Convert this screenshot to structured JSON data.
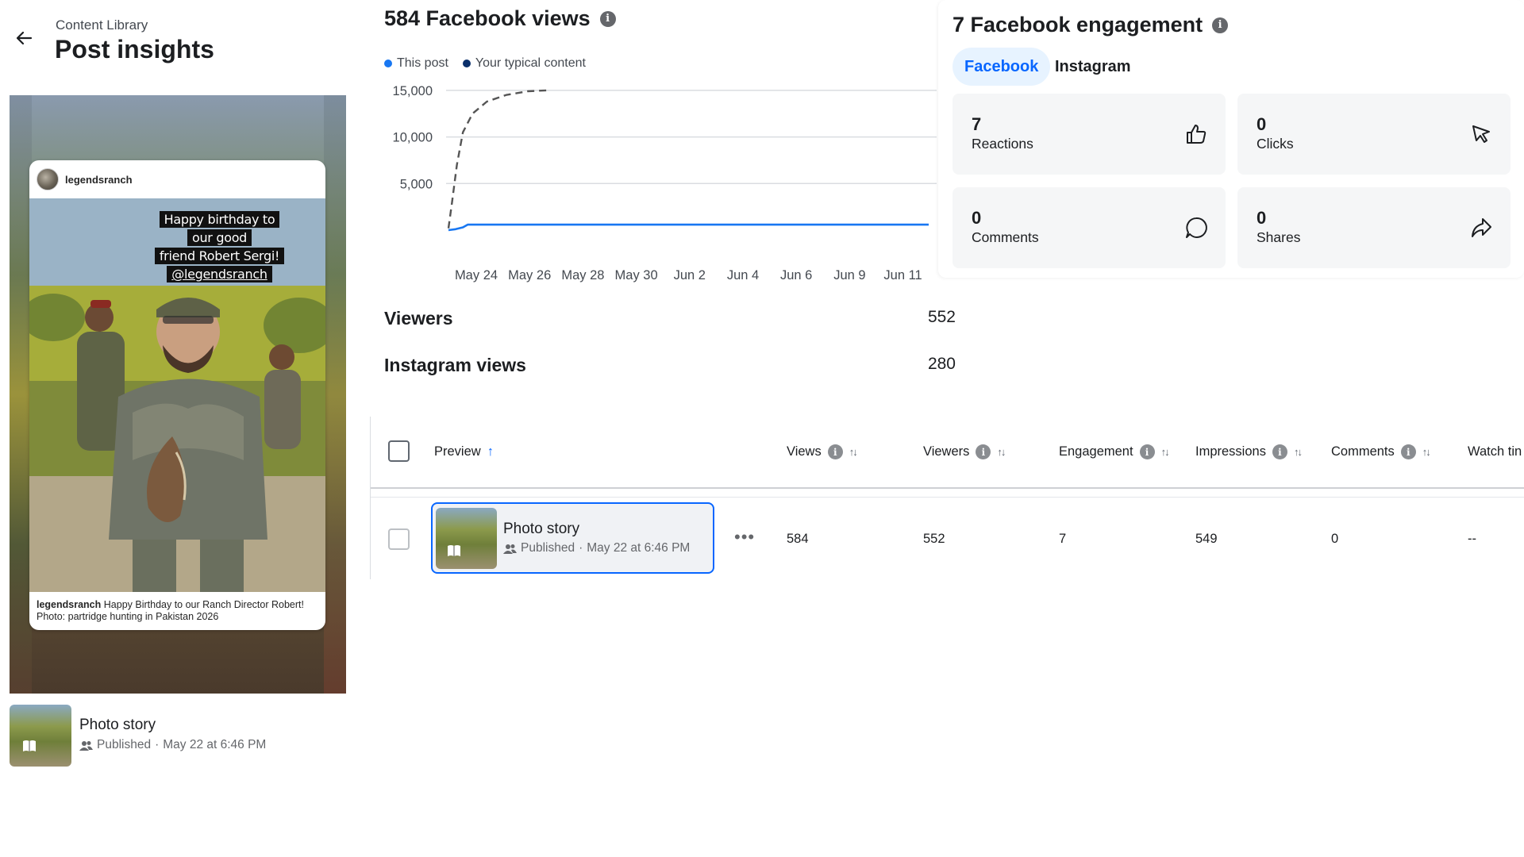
{
  "header": {
    "breadcrumb": "Content Library",
    "title": "Post insights",
    "back_icon": "arrow-left-icon"
  },
  "story": {
    "username": "legendsranch",
    "sticker_line1": "Happy birthday to our good",
    "sticker_line2": "friend Robert Sergi!",
    "sticker_handle": "@legendsranch",
    "caption_user": "legendsranch",
    "caption_text": "Happy Birthday to our Ranch Director Robert! Photo: partridge hunting in Pakistan 2026"
  },
  "post": {
    "title": "Photo story",
    "status": "Published",
    "separator": "·",
    "date": "May 22 at 6:46 PM"
  },
  "views_section": {
    "title": "584 Facebook views",
    "legend": [
      {
        "label": "This post",
        "color": "#1877f2"
      },
      {
        "label": "Your typical content",
        "color": "#0a2f6b"
      }
    ]
  },
  "chart_data": {
    "type": "line",
    "x_labels": [
      "May 24",
      "May 26",
      "May 28",
      "May 30",
      "Jun 2",
      "Jun 4",
      "Jun 6",
      "Jun 9",
      "Jun 11"
    ],
    "y_ticks": [
      5000,
      10000,
      15000
    ],
    "y_tick_labels": [
      "5,000",
      "10,000",
      "15,000"
    ],
    "ylim": [
      0,
      15500
    ],
    "grid": true,
    "series": [
      {
        "name": "This post",
        "style": "solid",
        "color": "#1877f2",
        "points": [
          [
            0,
            0
          ],
          [
            0.3,
            100
          ],
          [
            0.6,
            300
          ],
          [
            0.8,
            584
          ],
          [
            20,
            584
          ]
        ]
      },
      {
        "name": "Your typical content",
        "style": "dashed",
        "color": "#555555",
        "points": [
          [
            0,
            200
          ],
          [
            0.15,
            3000
          ],
          [
            0.35,
            7000
          ],
          [
            0.6,
            10500
          ],
          [
            1.0,
            12500
          ],
          [
            1.6,
            13800
          ],
          [
            2.4,
            14500
          ],
          [
            3.3,
            14900
          ],
          [
            4.1,
            15000
          ]
        ]
      }
    ],
    "x_span": 20
  },
  "summary": {
    "viewers_label": "Viewers",
    "viewers_value": "552",
    "ig_label": "Instagram views",
    "ig_value": "280"
  },
  "engagement": {
    "title": "7 Facebook engagement",
    "tabs": [
      "Facebook",
      "Instagram"
    ],
    "cards": [
      {
        "value": "7",
        "label": "Reactions",
        "icon": "thumbs-up-icon"
      },
      {
        "value": "0",
        "label": "Clicks",
        "icon": "cursor-icon"
      },
      {
        "value": "0",
        "label": "Comments",
        "icon": "comment-bubble-icon"
      },
      {
        "value": "0",
        "label": "Shares",
        "icon": "share-arrow-icon"
      }
    ]
  },
  "table": {
    "columns": [
      "Preview",
      "Views",
      "Viewers",
      "Engagement",
      "Impressions",
      "Comments",
      "Watch tin"
    ],
    "sort_up": "↑",
    "sort_both": "↑↓",
    "row": {
      "views": "584",
      "viewers": "552",
      "engagement": "7",
      "impressions": "549",
      "comments": "0",
      "watch": "--"
    },
    "more": "•••"
  },
  "colors": {
    "accent": "#0866ff",
    "this_post": "#1877f2",
    "typical": "#555555"
  }
}
